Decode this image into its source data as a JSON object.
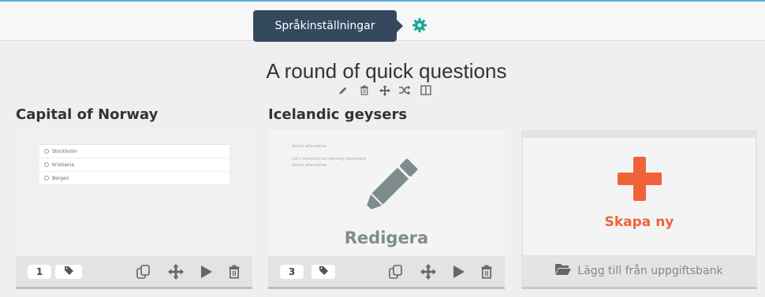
{
  "topbar": {
    "tooltip": "Språkinställningar"
  },
  "page": {
    "title": "A round of quick questions"
  },
  "cards": [
    {
      "title": "Capital of Norway",
      "count": "1",
      "preview_options": [
        "Stockholm",
        "Kristiania",
        "Bergen"
      ]
    },
    {
      "title": "Icelandic geysers",
      "count": "3",
      "edit_label": "Redigera",
      "preview_lines": [
        "Select alternative",
        "Let's introduce an opening statement",
        "Select alternative"
      ]
    }
  ],
  "new_card": {
    "create_label": "Skapa ny",
    "bank_label": "Lägg till från uppgiftsbank"
  },
  "colors": {
    "accent_orange": "#f0633a",
    "gear_teal": "#1aa694",
    "tooltip_bg": "#34495e"
  }
}
